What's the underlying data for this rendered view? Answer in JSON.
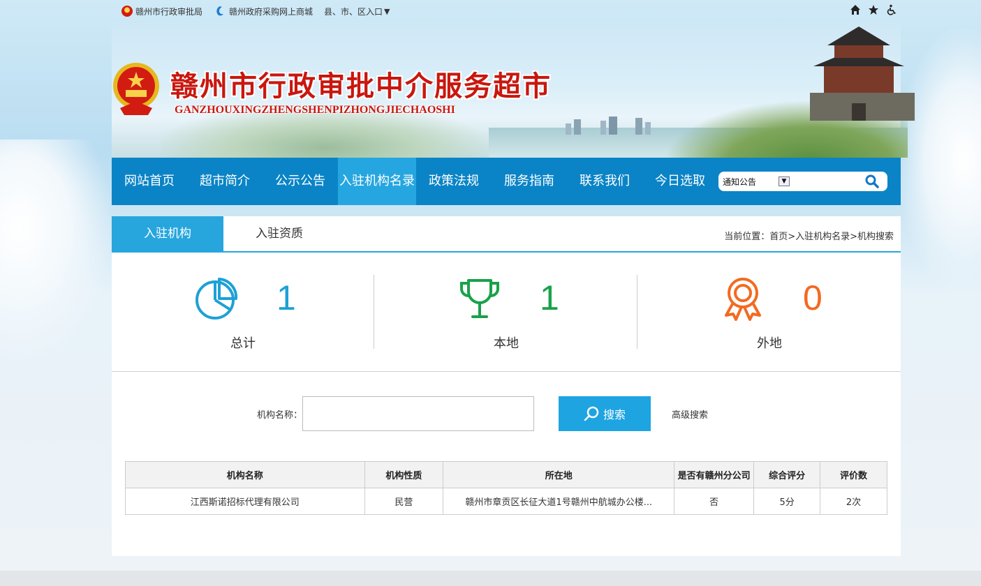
{
  "topbar": {
    "link1": "赣州市行政审批局",
    "link2": "赣州政府采购网上商城",
    "link3": "县、市、区入口",
    "link3_caret": "▼",
    "icons": [
      "home-icon",
      "star-icon",
      "accessibility-icon"
    ]
  },
  "banner": {
    "title": "赣州市行政审批中介服务超市",
    "subtitle": "GANZHOUXINGZHENGSHENPIZHONGJIECHAOSHI"
  },
  "nav": {
    "items": [
      "网站首页",
      "超市简介",
      "公示公告",
      "入驻机构名录",
      "政策法规",
      "服务指南",
      "联系我们",
      "今日选取"
    ],
    "active": "入驻机构名录",
    "search_select": "通知公告",
    "select_arrow": "▼"
  },
  "tabs": {
    "tab1": "入驻机构",
    "tab2": "入驻资质",
    "breadcrumb": "当前位置：首页>入驻机构名录>机构搜索"
  },
  "stats": [
    {
      "label": "总计",
      "value": "1",
      "color": "#1ea0d6",
      "icon": "pie-chart-icon"
    },
    {
      "label": "本地",
      "value": "1",
      "color": "#1aa14a",
      "icon": "trophy-icon"
    },
    {
      "label": "外地",
      "value": "0",
      "color": "#f26a21",
      "icon": "award-ribbon-icon"
    }
  ],
  "search": {
    "label": "机构名称：",
    "value": "",
    "button": "搜索",
    "advanced": "高级搜索"
  },
  "table": {
    "headers": [
      "机构名称",
      "机构性质",
      "所在地",
      "是否有赣州分公司",
      "综合评分",
      "评价数"
    ],
    "rows": [
      [
        "江西斯诺招标代理有限公司",
        "民营",
        "赣州市章贡区长征大道1号赣州中航城办公楼...",
        "否",
        "5分",
        "2次"
      ]
    ]
  },
  "colors": {
    "nav_bg": "#0a84c6",
    "nav_active": "#26a6e0",
    "accent": "#27a6de",
    "title_red": "#c8170f"
  }
}
